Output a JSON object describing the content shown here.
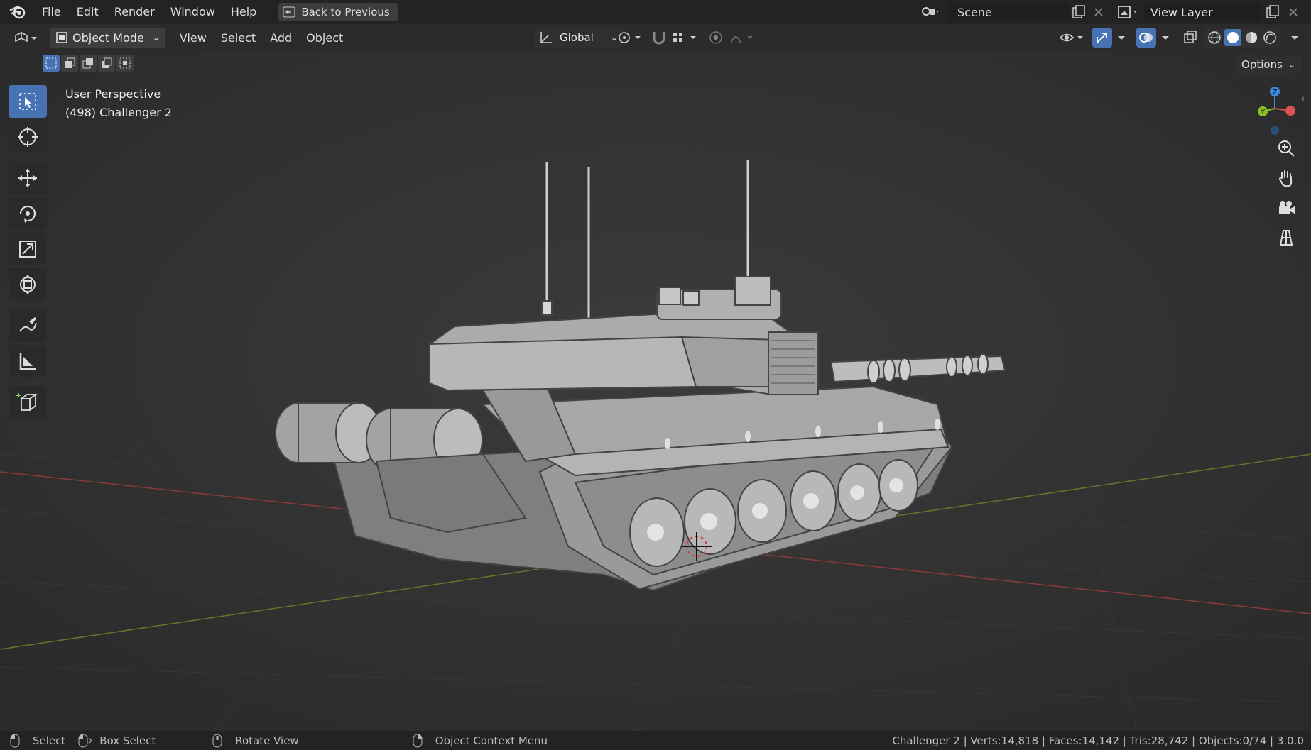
{
  "menu": {
    "items": [
      "File",
      "Edit",
      "Render",
      "Window",
      "Help"
    ],
    "back_button": "Back to Previous"
  },
  "scene": {
    "label": "Scene",
    "view_layer": "View Layer"
  },
  "header": {
    "mode": "Object Mode",
    "menus": [
      "View",
      "Select",
      "Add",
      "Object"
    ],
    "orientation": "Global",
    "options": "Options"
  },
  "viewport": {
    "view_name": "User Perspective",
    "object_info": "(498) Challenger 2"
  },
  "tools": [
    {
      "name": "select-box-tool",
      "icon": "cursor-select-icon"
    },
    {
      "name": "cursor-tool",
      "icon": "3d-cursor-icon"
    },
    {
      "name": "move-tool",
      "icon": "move-arrows-icon"
    },
    {
      "name": "rotate-tool",
      "icon": "rotate-icon"
    },
    {
      "name": "scale-tool",
      "icon": "scale-icon"
    },
    {
      "name": "transform-tool",
      "icon": "transform-icon"
    },
    {
      "name": "annotate-tool",
      "icon": "pencil-icon"
    },
    {
      "name": "measure-tool",
      "icon": "ruler-icon"
    },
    {
      "name": "add-cube-tool",
      "icon": "cube-add-icon"
    }
  ],
  "status": {
    "select": "Select",
    "box_select": "Box Select",
    "rotate_view": "Rotate View",
    "context_menu": "Object Context Menu",
    "stats": "Challenger 2 | Verts:14,818 | Faces:14,142 | Tris:28,742 | Objects:0/74 | 3.0.0"
  },
  "colors": {
    "accent": "#4772b3",
    "background": "#303030",
    "x_axis": "#8a3a3a",
    "y_axis": "#5d7a2e",
    "gizmo_x": "#d9534f",
    "gizmo_y": "#8cbf26",
    "gizmo_z": "#3b8bd9"
  }
}
